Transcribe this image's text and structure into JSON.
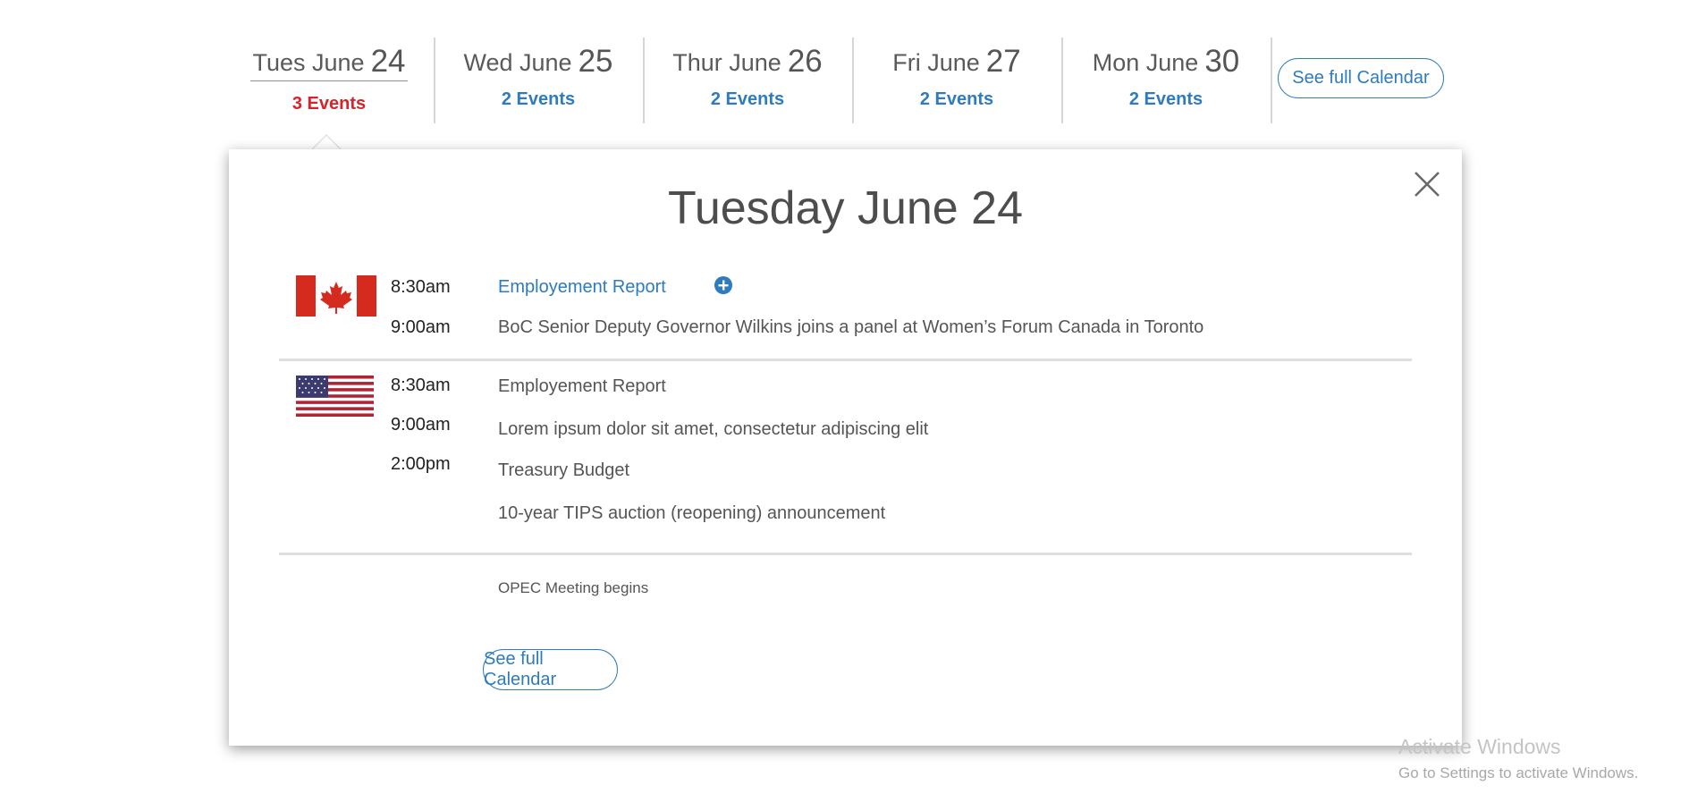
{
  "day_strip": {
    "days": [
      {
        "name": "Tues June",
        "num": "24",
        "count": "3 Events",
        "active": true
      },
      {
        "name": "Wed June",
        "num": "25",
        "count": "2 Events",
        "active": false
      },
      {
        "name": "Thur June",
        "num": "26",
        "count": "2 Events",
        "active": false
      },
      {
        "name": "Fri June",
        "num": "27",
        "count": "2 Events",
        "active": false
      },
      {
        "name": "Mon June",
        "num": "30",
        "count": "2 Events",
        "active": false
      }
    ],
    "see_full_calendar": "See full Calendar"
  },
  "popup": {
    "title": "Tuesday June 24",
    "close_icon": "close-icon",
    "sections": [
      {
        "country": "Canada",
        "flag_icon": "canada-flag-icon",
        "rows": [
          {
            "time": "8:30am",
            "event": "Employement Report",
            "link": true,
            "icon": "plus-circle-icon"
          },
          {
            "time": "9:00am",
            "event": "BoC Senior Deputy Governor Wilkins joins a panel at Women’s Forum Canada in Toronto"
          }
        ]
      },
      {
        "country": "United States",
        "flag_icon": "us-flag-icon",
        "times": [
          "8:30am",
          "9:00am",
          "2:00pm"
        ],
        "events": [
          "Employement Report",
          "Lorem ipsum dolor sit amet, consectetur adipiscing elit",
          "Treasury Budget",
          "10-year TIPS auction (reopening) announcement"
        ]
      },
      {
        "events": [
          "OPEC Meeting begins"
        ]
      }
    ],
    "see_full_calendar": "See full Calendar"
  },
  "watermark": {
    "title": "Activate Windows",
    "subtitle": "Go to Settings to activate Windows."
  },
  "colors": {
    "accent_blue": "#2e7bbd",
    "active_red": "#d8232a",
    "canada_red": "#d52b1e",
    "us_blue": "#3c3b6e",
    "us_red": "#b22234"
  }
}
